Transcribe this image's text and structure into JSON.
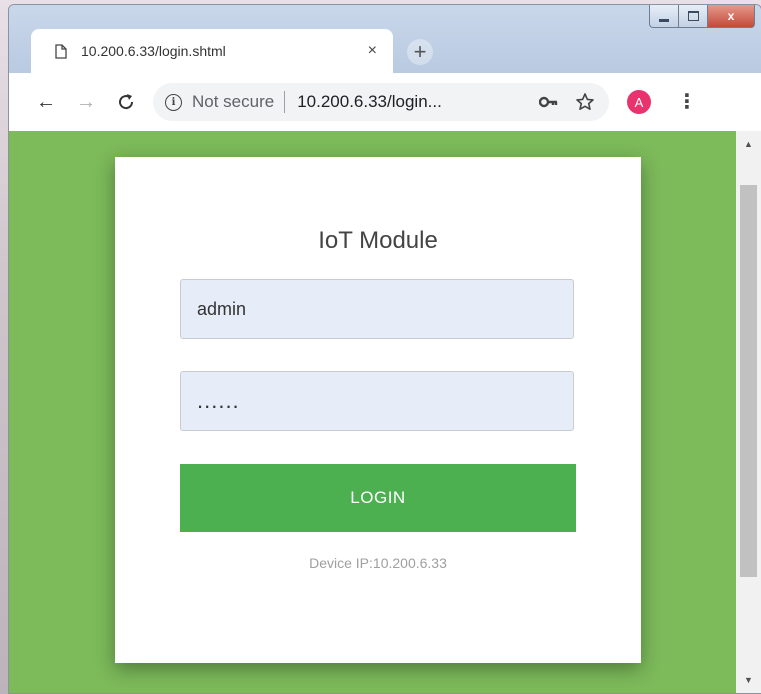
{
  "browser": {
    "tab": {
      "title": "10.200.6.33/login.shtml",
      "close_glyph": "×"
    },
    "new_tab_glyph": "+",
    "toolbar": {
      "back_glyph": "←",
      "forward_glyph": "→",
      "reload_glyph": "C",
      "security_label": "Not secure",
      "url": "10.200.6.33/login...",
      "avatar_letter": "A",
      "menu_glyph": "⋮"
    },
    "window_controls": {
      "close_glyph": "x"
    }
  },
  "login": {
    "title": "IoT Module",
    "username_value": "admin",
    "password_value": "......",
    "button_label": "LOGIN",
    "device_ip": "Device IP:10.200.6.33"
  },
  "colors": {
    "page_background": "#7cba5a",
    "button": "#4caf50",
    "avatar": "#e8336f"
  },
  "icons": {
    "tab": "page-icon",
    "security": "info-icon",
    "password_manager": "key-icon",
    "bookmark": "star-icon"
  }
}
